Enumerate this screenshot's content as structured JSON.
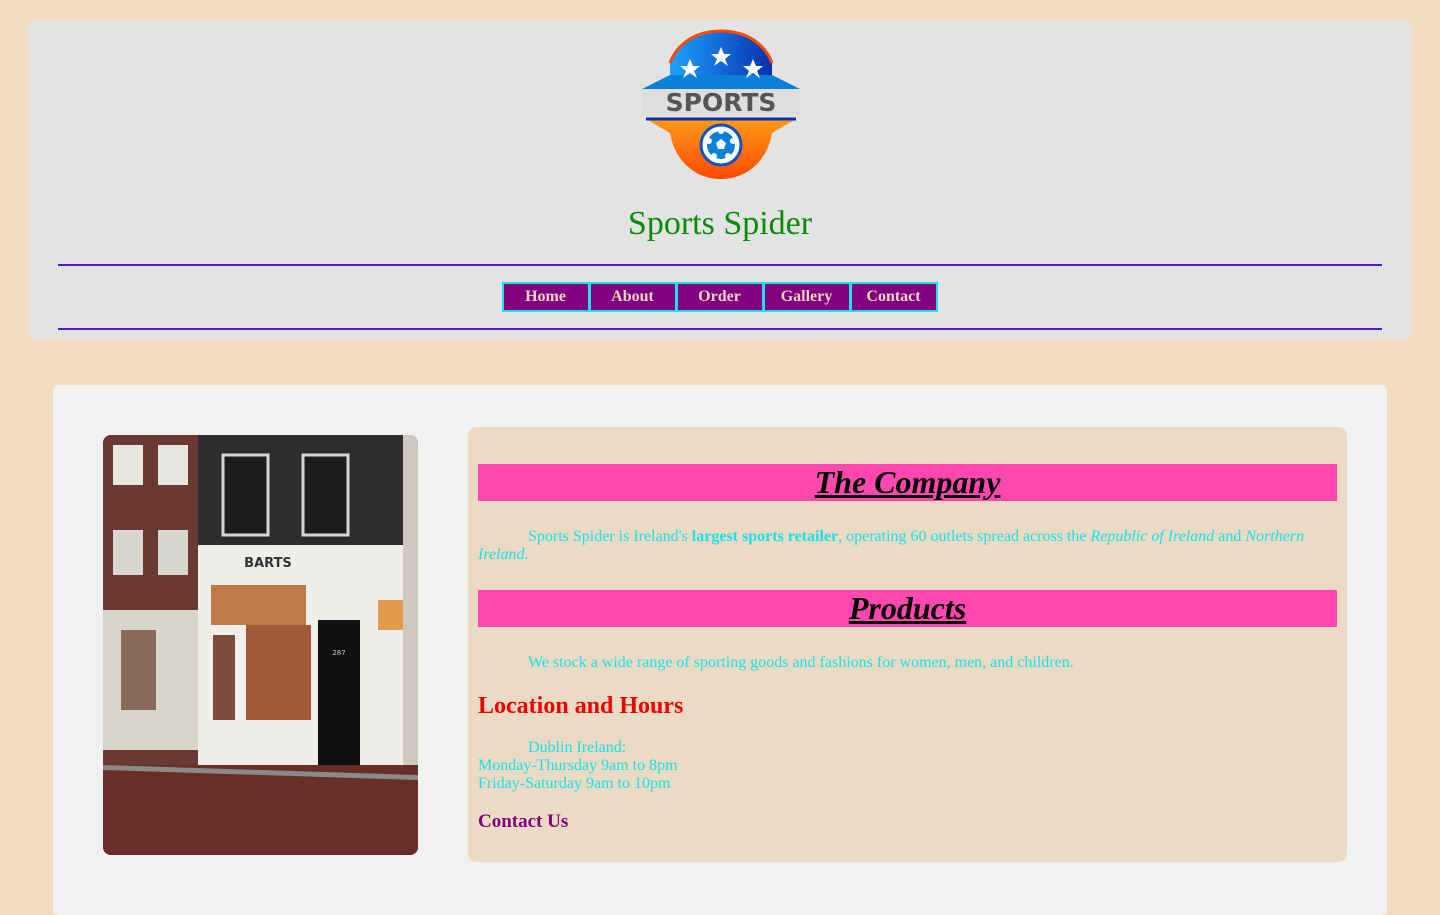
{
  "header": {
    "logo_text": "SPORTS",
    "site_title": "Sports Spider",
    "nav": [
      "Home",
      "About",
      "Order",
      "Gallery",
      "Contact"
    ]
  },
  "photo": {
    "storefront_sign": "BARTS",
    "door_number": "287"
  },
  "company": {
    "heading": "The Company",
    "p_start": "Sports Spider is Ireland's ",
    "p_bold": "largest sports retailer",
    "p_mid": ", operating 60 outlets spread across the ",
    "p_italic1": "Republic of Ireland",
    "p_and": " and ",
    "p_italic2": "Northern Ireland."
  },
  "products": {
    "heading": "Products",
    "text": "We stock a wide range of sporting goods and fashions for women, men, and children."
  },
  "location": {
    "heading": "Location and Hours",
    "lines": [
      "Dublin Ireland:",
      "Monday-Thursday 9am to 8pm",
      "Friday-Saturday 9am to 10pm"
    ]
  },
  "contact_link": "Contact Us",
  "colors": {
    "page_bg": "#f2dcbf",
    "header_bg": "#e3e3e3",
    "title_green": "#0a8a0a",
    "nav_bg": "#800080",
    "nav_border": "#22e0e6",
    "section_pink": "#ff47b0",
    "body_cyan": "#19e0e6",
    "heading_red": "#f00000"
  }
}
